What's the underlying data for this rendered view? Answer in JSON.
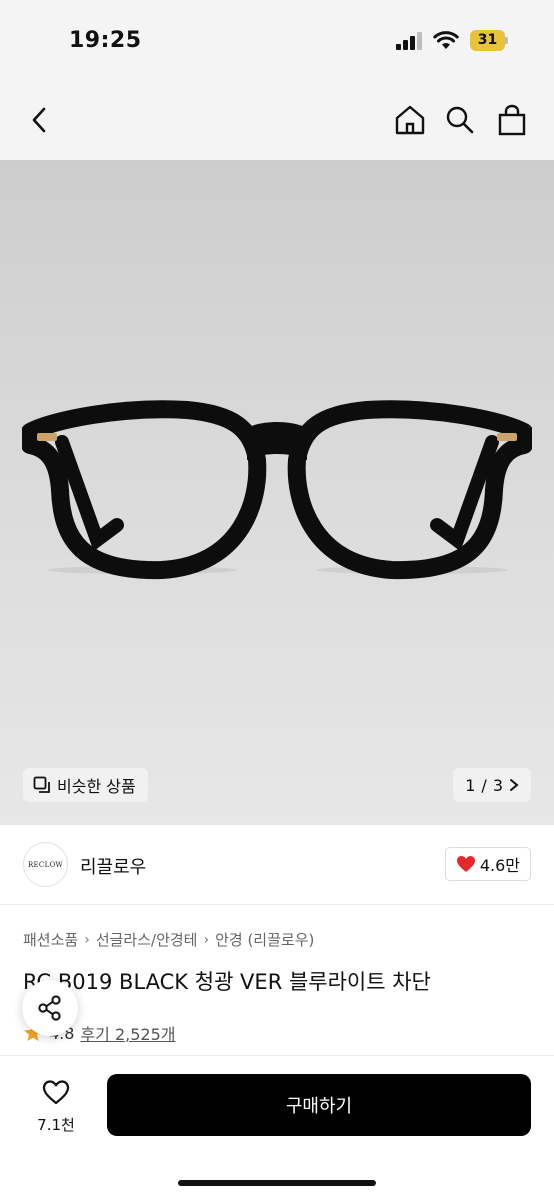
{
  "status": {
    "time": "19:25",
    "battery": "31"
  },
  "header": {
    "back_icon": "back-icon",
    "home_icon": "home-icon",
    "search_icon": "search-icon",
    "bag_icon": "shopping-bag-icon"
  },
  "gallery": {
    "similar_label": "비슷한 상품",
    "current": "1",
    "separator": "/",
    "total": "3"
  },
  "store": {
    "logo_text": "RECLOW",
    "name": "리끌로우",
    "likes": "4.6만"
  },
  "product": {
    "breadcrumb": [
      "패션소품",
      "선글라스/안경테",
      "안경 (리끌로우)"
    ],
    "title": "RC B019 BLACK 청광 VER 블루라이트 차단",
    "rating": "4.8",
    "reviews": "후기 2,525개"
  },
  "bottom": {
    "wish_count": "7.1천",
    "buy_label": "구매하기"
  },
  "colors": {
    "accent": "#000000",
    "heart": "#e5282b",
    "star": "#f5a623"
  }
}
